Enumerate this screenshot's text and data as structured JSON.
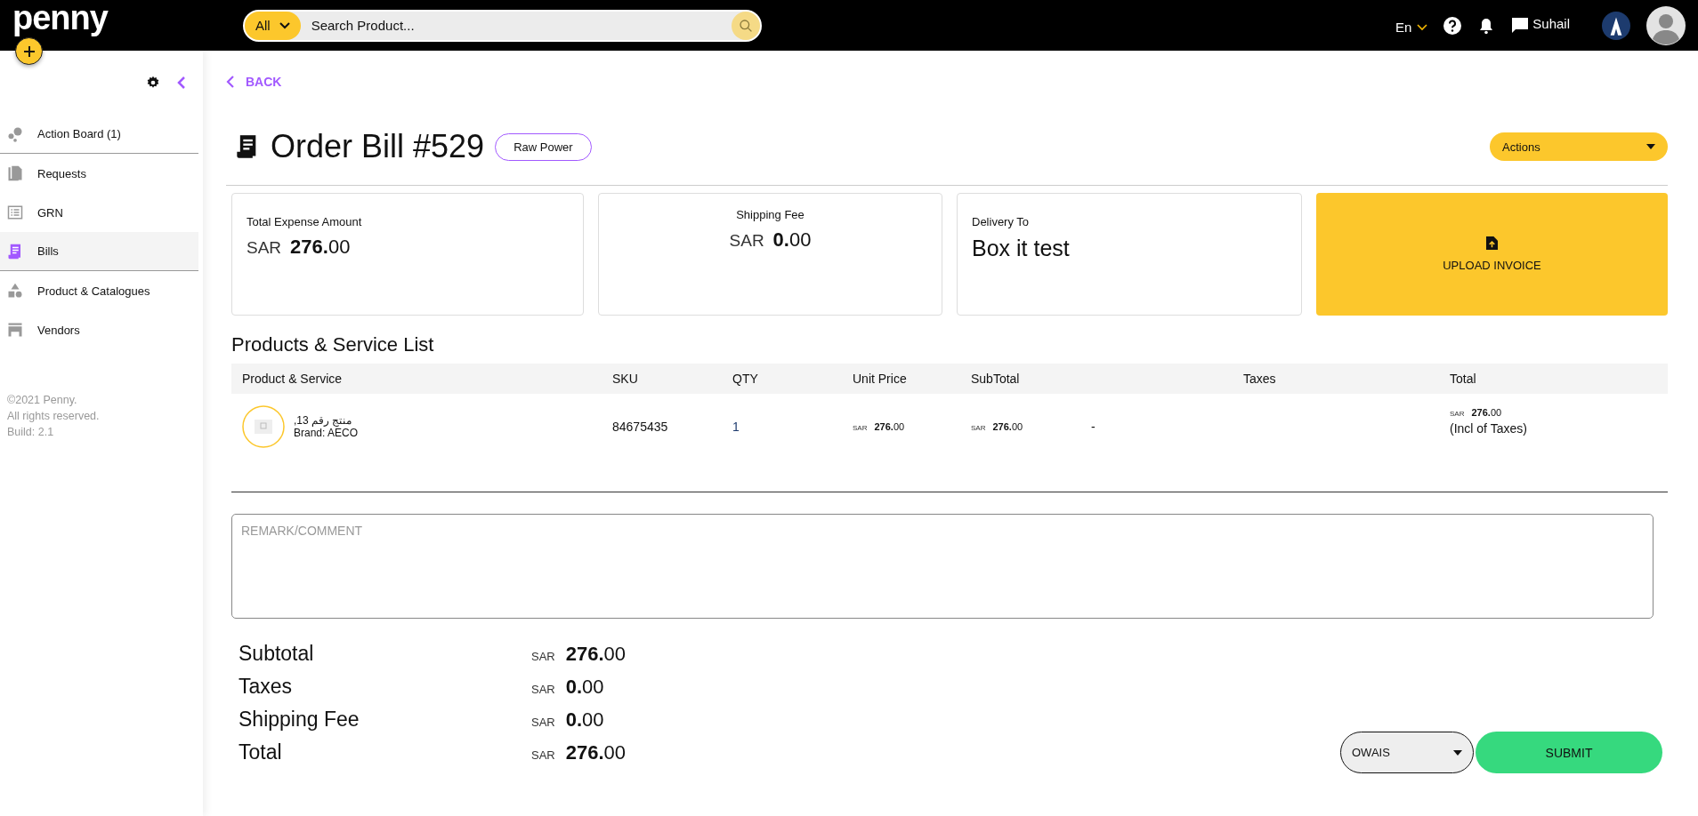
{
  "topbar": {
    "logo": "penny",
    "search": {
      "scope": "All",
      "placeholder": "Search Product..."
    },
    "language": "En",
    "user": "Suhail"
  },
  "sidebar": {
    "items": [
      {
        "label": "Action Board (1)",
        "selected": false
      },
      {
        "label": "Requests",
        "selected": false
      },
      {
        "label": "GRN",
        "selected": false
      },
      {
        "label": "Bills",
        "selected": true
      },
      {
        "label": "Product & Catalogues",
        "selected": false
      },
      {
        "label": "Vendors",
        "selected": false
      }
    ],
    "footer": [
      "©2021 Penny.",
      "All rights reserved.",
      "Build: 2.1"
    ]
  },
  "back": "BACK",
  "header": {
    "title": "Order Bill #529",
    "tag": "Raw Power",
    "actions": "Actions"
  },
  "cards": [
    {
      "kind": "amount",
      "label": "Total Expense Amount",
      "currency": "SAR",
      "amount": "**276.**00"
    },
    {
      "kind": "amount_center",
      "label": "Shipping Fee",
      "currency": "SAR",
      "amount": "**0.**00"
    },
    {
      "kind": "text",
      "label": "Delivery To",
      "value": "Box it test"
    },
    {
      "kind": "upload",
      "label": "UPLOAD INVOICE"
    }
  ],
  "list_title": "Products & Service List",
  "table": {
    "columns": [
      "Product & Service",
      "SKU",
      "QTY",
      "Unit Price",
      "SubTotal",
      "Taxes",
      "Total"
    ],
    "rows": [
      {
        "name": "منتج رقم 13,",
        "brand": "Brand: AECO",
        "sku": "84675435",
        "qty": "1",
        "unit_price": {
          "currency": "SAR",
          "amount": "**276.**00"
        },
        "subtotal": {
          "currency": "SAR",
          "amount": "**276.**00"
        },
        "column_6": "-",
        "total": {
          "currency": "SAR",
          "amount": "**276.**00",
          "note": "(Incl of Taxes)"
        }
      }
    ]
  },
  "remark": {
    "placeholder": "REMARK/COMMENT"
  },
  "summary": [
    {
      "label": "Subtotal",
      "currency": "SAR",
      "amount": "**276.**00"
    },
    {
      "label": "Taxes",
      "currency": "SAR",
      "amount": "**0.**00"
    },
    {
      "label": "Shipping Fee",
      "currency": "SAR",
      "amount": "**0.**00"
    },
    {
      "label": "Total",
      "currency": "SAR",
      "amount": "**276.**00"
    }
  ],
  "approver": "OWAIS",
  "submit": "SUBMIT"
}
